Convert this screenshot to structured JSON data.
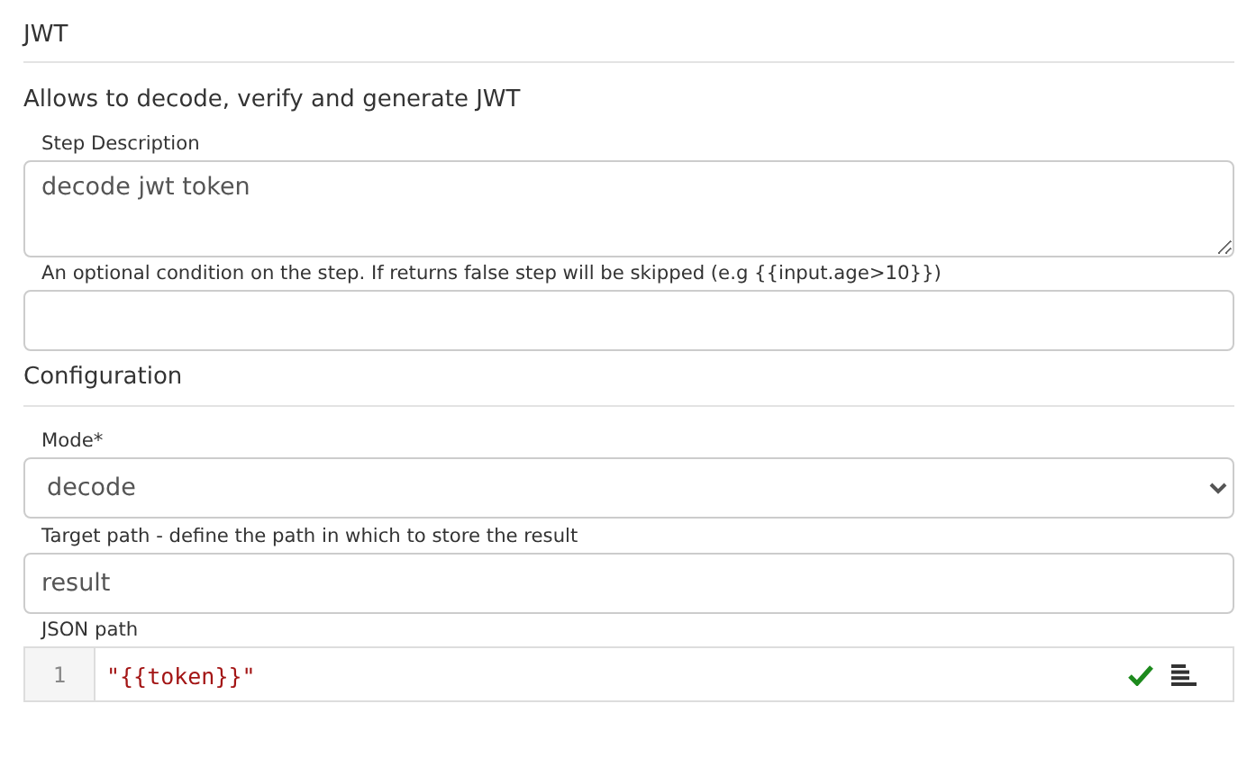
{
  "title": "JWT",
  "description": "Allows to decode, verify and generate JWT",
  "step_fields": [
    {
      "kind": "textarea",
      "label": "Step Description",
      "value": "decode jwt token"
    },
    {
      "kind": "input",
      "label": "An optional condition on the step. If returns false step will be skipped (e.g {{input.age>10}})"
    }
  ],
  "configuration": {
    "title": "Configuration",
    "fields": [
      {
        "kind": "select",
        "label": "Mode*",
        "value": "decode"
      },
      {
        "kind": "input",
        "label": "Target path - define the path in which to store the result",
        "value": "result"
      },
      {
        "kind": "code",
        "label": "JSON path",
        "line_number": "1",
        "value": "\"{{token}}\"",
        "valid": true
      }
    ]
  }
}
